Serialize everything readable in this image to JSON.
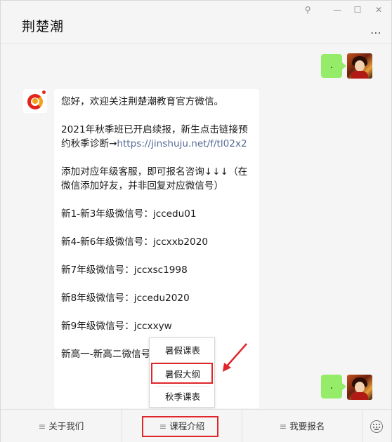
{
  "window": {
    "title": "荆楚潮",
    "controls": {
      "pin": "⚲",
      "minimize": "—",
      "maximize": "☐",
      "close": "✕"
    },
    "more_icon": "⋯"
  },
  "chat": {
    "sent_message_1": ".",
    "sent_message_2": ".",
    "received": {
      "line1": "您好，欢迎关注荆楚潮教育官方微信。",
      "line2_text": "2021年秋季班已开启续报，新生点击链接预约秋季诊断→",
      "line2_link": "https://jinshuju.net/f/tl02x2",
      "line3": "添加对应年级客服，即可报名咨询↓↓↓（在微信添加好友，并非回复对应微信号）",
      "line4": "新1-新3年级微信号：jccedu01",
      "line5": "新4-新6年级微信号：jccxxb2020",
      "line6": "新7年级微信号：jccxsc1998",
      "line7": "新8年级微信号：jccedu2020",
      "line8": "新9年级微信号：jccxxyw",
      "line9": "新高一-新高二微信号"
    }
  },
  "popup_menu": {
    "items": [
      "暑假课表",
      "暑假大纲",
      "秋季课表"
    ],
    "highlighted": "暑假大纲"
  },
  "bottom_menu": {
    "items": [
      "关于我们",
      "课程介绍",
      "我要报名"
    ],
    "menu_glyph": "≡",
    "highlighted": "课程介绍"
  },
  "colors": {
    "green_bubble": "#95ec69",
    "link": "#576b95",
    "highlight": "#e0262b"
  }
}
